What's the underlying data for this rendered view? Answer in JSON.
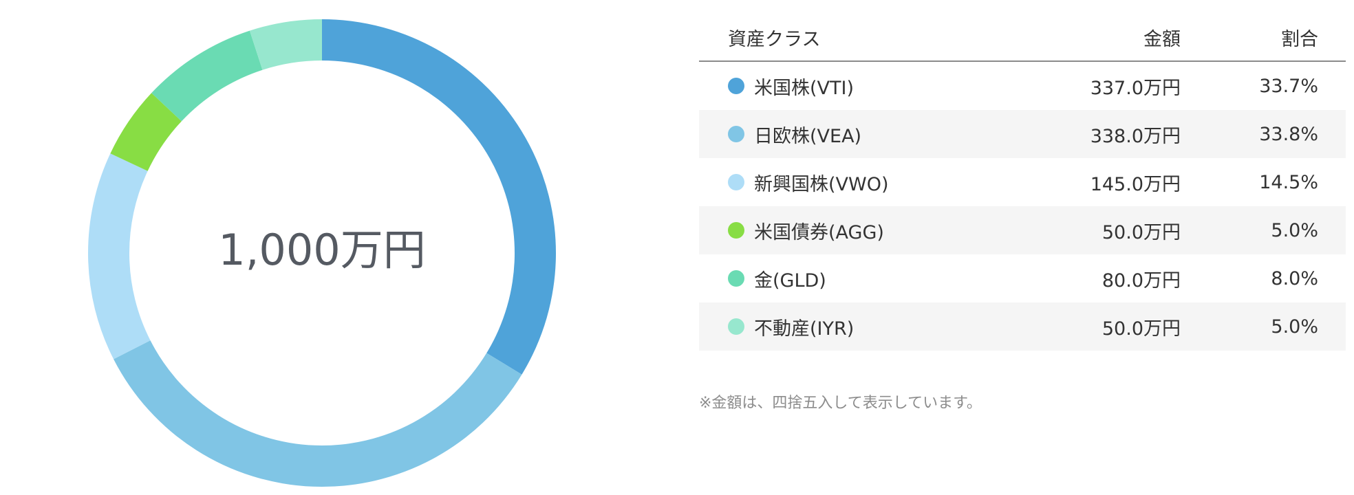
{
  "chart_data": {
    "type": "pie",
    "center_label": "1,000万円",
    "categories": [
      "米国株(VTI)",
      "日欧株(VEA)",
      "新興国株(VWO)",
      "米国債券(AGG)",
      "金(GLD)",
      "不動産(IYR)"
    ],
    "values": [
      33.7,
      33.8,
      14.5,
      5.0,
      8.0,
      5.0
    ],
    "colors": [
      "#4fa3d9",
      "#80c5e5",
      "#aeddf7",
      "#88dd44",
      "#6adbb3",
      "#97e7ce"
    ]
  },
  "table": {
    "headers": {
      "name": "資産クラス",
      "amount": "金額",
      "ratio": "割合"
    },
    "rows": [
      {
        "name": "米国株(VTI)",
        "amount": "337.0万円",
        "ratio": "33.7%",
        "color": "#4fa3d9"
      },
      {
        "name": "日欧株(VEA)",
        "amount": "338.0万円",
        "ratio": "33.8%",
        "color": "#80c5e5"
      },
      {
        "name": "新興国株(VWO)",
        "amount": "145.0万円",
        "ratio": "14.5%",
        "color": "#aeddf7"
      },
      {
        "name": "米国債券(AGG)",
        "amount": "50.0万円",
        "ratio": "5.0%",
        "color": "#88dd44"
      },
      {
        "name": "金(GLD)",
        "amount": "80.0万円",
        "ratio": "8.0%",
        "color": "#6adbb3"
      },
      {
        "name": "不動産(IYR)",
        "amount": "50.0万円",
        "ratio": "5.0%",
        "color": "#97e7ce"
      }
    ]
  },
  "footnote": "※金額は、四捨五入して表示しています。"
}
